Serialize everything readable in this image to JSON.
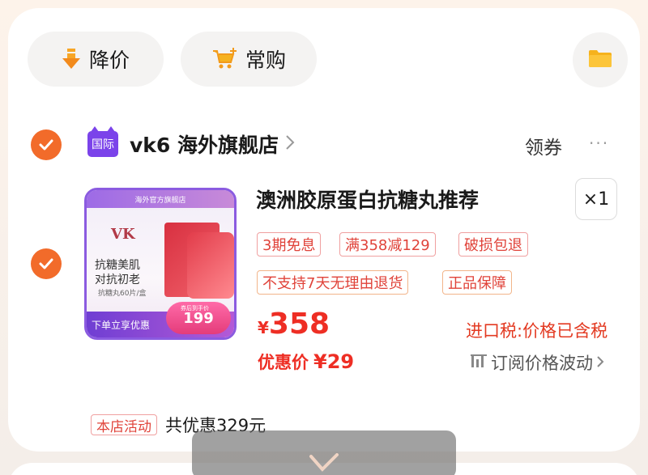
{
  "filters": {
    "price_drop_label": "降价",
    "frequent_label": "常购"
  },
  "store": {
    "badge": "国际",
    "name": "vk6 海外旗舰店",
    "coupon_label": "领券",
    "more_label": "···"
  },
  "product": {
    "thumb": {
      "top_banner": "海外官方旗舰店",
      "logo": "VK",
      "line1": "抗糖美肌",
      "line2": "对抗初老",
      "line3": "抗糖丸60片/盒",
      "promo": "下单立享优惠",
      "bubble_price": "199",
      "bubble_small": "券后到手价"
    },
    "title": "澳洲胶原蛋白抗糖丸推荐",
    "quantity": "×1",
    "tags_row1": [
      "3期免息",
      "满358减129",
      "破损包退"
    ],
    "tags_row2": [
      "不支持7天无理由退货",
      "正品保障"
    ],
    "price_currency": "¥",
    "price": "358",
    "tax_note": "进口税:价格已含税",
    "discount_label": "优惠价",
    "discount_price": "¥29",
    "subscribe_label": "订阅价格波动"
  },
  "activity": {
    "tag": "本店活动",
    "text": "共优惠329元"
  },
  "colors": {
    "accent": "#f26b2a",
    "price_red": "#ee2e24",
    "intl_purple": "#7b43ea"
  }
}
